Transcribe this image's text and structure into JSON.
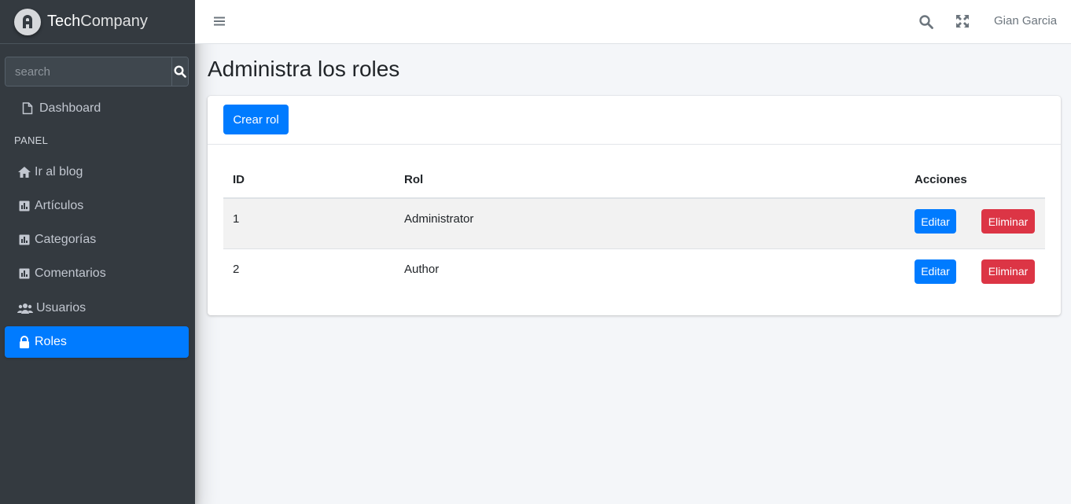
{
  "brand": {
    "name_bold": "Tech",
    "name_rest": "Company"
  },
  "sidebar": {
    "search_placeholder": "search",
    "dashboard": "Dashboard",
    "section_header": "PANEL",
    "items": [
      {
        "label": "Ir al blog",
        "icon": "home-icon"
      },
      {
        "label": "Artículos",
        "icon": "chart-icon"
      },
      {
        "label": "Categorías",
        "icon": "chart-icon"
      },
      {
        "label": "Comentarios",
        "icon": "chart-icon"
      },
      {
        "label": "Usuarios",
        "icon": "users-icon"
      },
      {
        "label": "Roles",
        "icon": "lock-icon",
        "active": true
      }
    ]
  },
  "topbar": {
    "user": "Gian Garcia"
  },
  "page": {
    "title": "Administra los roles",
    "create_button": "Crear rol"
  },
  "table": {
    "headers": [
      "ID",
      "Rol",
      "Acciones"
    ],
    "rows": [
      {
        "id": "1",
        "role": "Administrator",
        "edit": "Editar",
        "delete": "Eliminar"
      },
      {
        "id": "2",
        "role": "Author",
        "edit": "Editar",
        "delete": "Eliminar"
      }
    ]
  },
  "colors": {
    "primary": "#007bff",
    "danger": "#dc3545",
    "sidebar": "#343a40"
  }
}
